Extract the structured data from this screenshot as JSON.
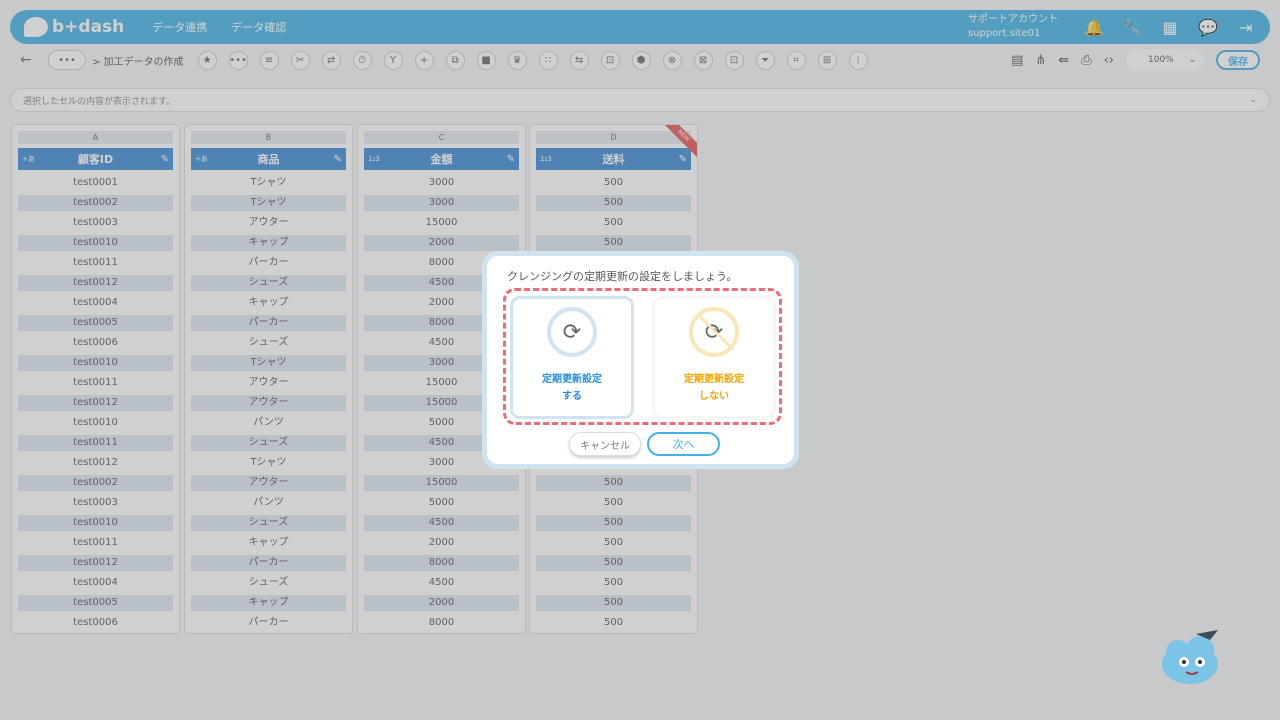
{
  "topbar": {
    "logo": "b+dash",
    "nav": [
      "データ連携",
      "データ確認"
    ],
    "account_name": "サポートアカウント",
    "account_id": "support.site01",
    "icons": [
      "bell-icon",
      "wrench-icon",
      "grid-icon",
      "chat-icon",
      "logout-icon"
    ]
  },
  "toolbar": {
    "back": "←",
    "more": "•••",
    "breadcrumb": "> 加工データの作成",
    "tool_glyphs": [
      "★",
      "•••",
      "≡",
      "✂",
      "⇄",
      "⏱",
      "Y",
      "+",
      "⧉",
      "■",
      "♛",
      "∷",
      "⇆",
      "⊡",
      "⬢",
      "⊗",
      "⊠",
      "⊡",
      "⏷",
      "⌗",
      "⊞",
      "⦙"
    ],
    "right_icons": [
      "▤",
      "⋔",
      "⇚",
      "⎙",
      "‹›"
    ],
    "zoom": "100%",
    "save_label": "保存"
  },
  "cellbar": {
    "placeholder": "選択したセルの内容が表示されます。"
  },
  "table": {
    "columns": [
      {
        "letter": "A",
        "name": "顧客ID",
        "type": "+あ",
        "values": [
          "test0001",
          "test0002",
          "test0003",
          "test0010",
          "test0011",
          "test0012",
          "test0004",
          "test0005",
          "test0006",
          "test0010",
          "test0011",
          "test0012",
          "test0010",
          "test0011",
          "test0012",
          "test0002",
          "test0003",
          "test0010",
          "test0011",
          "test0012",
          "test0004",
          "test0005",
          "test0006"
        ]
      },
      {
        "letter": "B",
        "name": "商品",
        "type": "+あ",
        "values": [
          "Tシャツ",
          "Tシャツ",
          "アウター",
          "キャップ",
          "パーカー",
          "シューズ",
          "キャップ",
          "パーカー",
          "シューズ",
          "Tシャツ",
          "アウター",
          "アウター",
          "パンツ",
          "シューズ",
          "Tシャツ",
          "アウター",
          "パンツ",
          "シューズ",
          "キャップ",
          "パーカー",
          "シューズ",
          "キャップ",
          "パーカー"
        ]
      },
      {
        "letter": "C",
        "name": "金額",
        "type": "1₂3",
        "values": [
          "3000",
          "3000",
          "15000",
          "2000",
          "8000",
          "4500",
          "2000",
          "8000",
          "4500",
          "3000",
          "15000",
          "15000",
          "5000",
          "4500",
          "3000",
          "15000",
          "5000",
          "4500",
          "2000",
          "8000",
          "4500",
          "2000",
          "8000"
        ]
      },
      {
        "letter": "D",
        "name": "送料",
        "type": "1₂3",
        "badge": "NEW",
        "values": [
          "500",
          "500",
          "500",
          "500",
          "500",
          "500",
          "500",
          "500",
          "500",
          "500",
          "500",
          "500",
          "500",
          "500",
          "500",
          "500",
          "500",
          "500",
          "500",
          "500",
          "500",
          "500",
          "500"
        ]
      }
    ]
  },
  "modal": {
    "title": "クレンジングの定期更新の設定をしましょう。",
    "option_yes_line1": "定期更新設定",
    "option_yes_line2": "する",
    "option_no_line1": "定期更新設定",
    "option_no_line2": "しない",
    "cancel_label": "キャンセル",
    "next_label": "次へ"
  },
  "colors": {
    "brand": "#3fb3e6",
    "header": "#3b89d6",
    "dashed": "#ef6b78",
    "yes": "#2b8fd6",
    "no": "#f0a400"
  }
}
